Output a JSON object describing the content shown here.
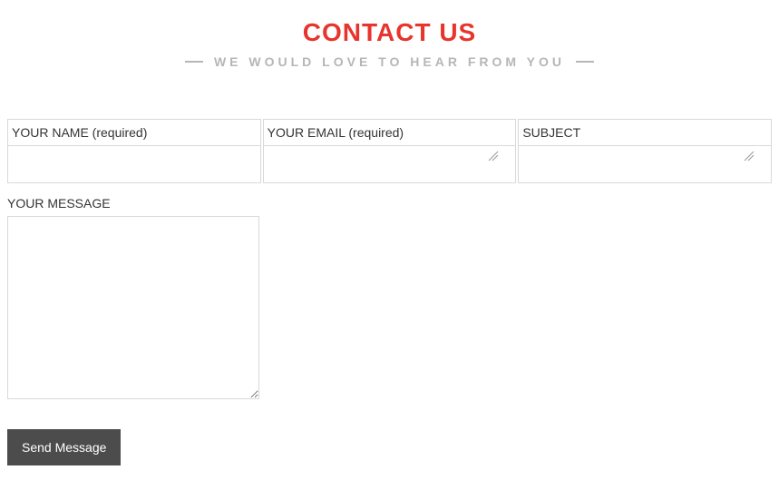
{
  "header": {
    "title": "CONTACT US",
    "subtitle": "WE WOULD LOVE TO HEAR FROM YOU"
  },
  "form": {
    "name": {
      "label": "YOUR NAME (required)",
      "value": ""
    },
    "email": {
      "label": "YOUR EMAIL (required)",
      "value": ""
    },
    "subject": {
      "label": "SUBJECT",
      "value": ""
    },
    "message": {
      "label": "YOUR MESSAGE",
      "value": ""
    },
    "submit_label": "Send Message"
  }
}
